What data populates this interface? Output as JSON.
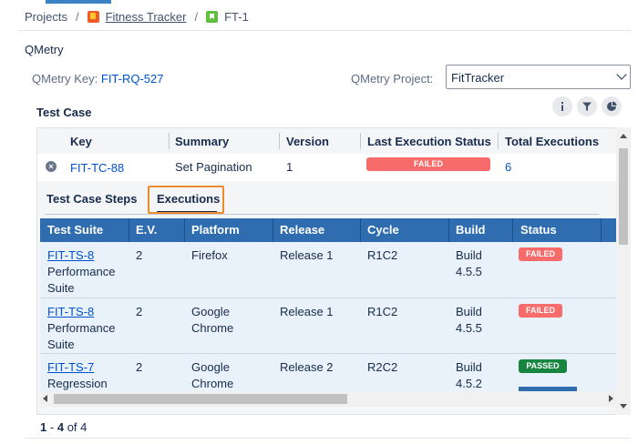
{
  "breadcrumb": {
    "root": "Projects",
    "sep1": "/",
    "project": "Fitness Tracker",
    "sep2": "/",
    "issue": "FT-1"
  },
  "section": {
    "title": "QMetry"
  },
  "qmetry_key": {
    "label": "QMetry Key:",
    "value": "FIT-RQ-527"
  },
  "qmetry_project": {
    "label": "QMetry Project:",
    "selected": "FitTracker"
  },
  "test_case": {
    "title": "Test Case",
    "toolbar_icons": [
      "info-icon",
      "filter-icon",
      "pie-chart-icon"
    ],
    "columns": [
      "Key",
      "Summary",
      "Version",
      "Last Execution Status",
      "Total Executions"
    ],
    "row": {
      "key": "FIT-TC-88",
      "summary": "Set Pagination",
      "version": "1",
      "last_status": "FAILED",
      "total_executions": "6"
    }
  },
  "tabs": [
    {
      "label": "Test Case Steps",
      "active": false
    },
    {
      "label": "Executions",
      "active": true
    }
  ],
  "executions": {
    "columns": [
      "Test Suite",
      "E.V.",
      "Platform",
      "Release",
      "Cycle",
      "Build",
      "Status"
    ],
    "rows": [
      {
        "suite_key": "FIT-TS-8",
        "suite_name": "Performance Suite",
        "ev": "2",
        "platform": "Firefox",
        "release": "Release 1",
        "cycle": "R1C2",
        "build": "Build 4.5.5",
        "status": "FAILED"
      },
      {
        "suite_key": "FIT-TS-8",
        "suite_name": "Performance Suite",
        "ev": "2",
        "platform": "Google Chrome",
        "release": "Release 1",
        "cycle": "R1C2",
        "build": "Build 4.5.5",
        "status": "FAILED"
      },
      {
        "suite_key": "FIT-TS-7",
        "suite_name": "Regression",
        "ev": "2",
        "platform": "Google Chrome",
        "release": "Release 2",
        "cycle": "R2C2",
        "build": "Build 4.5.2",
        "status": "PASSED"
      }
    ]
  },
  "pagination": {
    "range_start": "1",
    "dash": "-",
    "range_end": "4",
    "of": "of 4"
  },
  "colors": {
    "accent": "#2f6db0",
    "failed": "#f86b6b",
    "passed": "#16853f",
    "highlight": "#ed8b30",
    "link": "#0052cc"
  }
}
